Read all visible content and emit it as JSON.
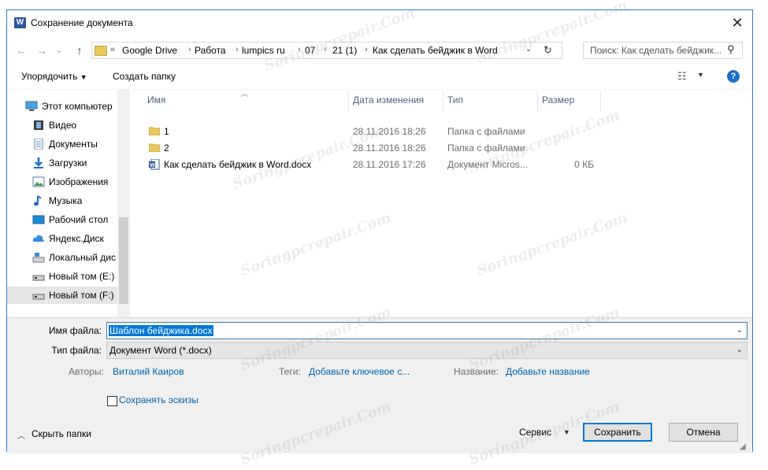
{
  "window": {
    "title": "Сохранение документа",
    "app_icon": "W",
    "close": "✕"
  },
  "nav": {
    "back": "←",
    "forward": "→",
    "dropdown": "⌄",
    "up": "↑",
    "breadcrumb": [
      "Google Drive",
      "Работа",
      "lumpics ru",
      "07",
      "21 (1)",
      "Как сделать бейджик в Word"
    ],
    "search_placeholder": "Поиск: Как сделать бейджик..."
  },
  "toolbar": {
    "organize": "Упорядочить",
    "new_folder": "Создать папку",
    "help": "?"
  },
  "sidebar": {
    "items": [
      {
        "label": "Этот компьютер",
        "icon": "computer-icon"
      },
      {
        "label": "Видео",
        "icon": "video-icon"
      },
      {
        "label": "Документы",
        "icon": "documents-icon"
      },
      {
        "label": "Загрузки",
        "icon": "downloads-icon"
      },
      {
        "label": "Изображения",
        "icon": "pictures-icon"
      },
      {
        "label": "Музыка",
        "icon": "music-icon"
      },
      {
        "label": "Рабочий стол",
        "icon": "desktop-icon"
      },
      {
        "label": "Яндекс.Диск",
        "icon": "cloud-icon"
      },
      {
        "label": "Локальный дис",
        "icon": "local-disk-icon"
      },
      {
        "label": "Новый том (E:)",
        "icon": "drive-icon"
      },
      {
        "label": "Новый том (F:)",
        "icon": "drive-icon"
      }
    ]
  },
  "columns": {
    "name": "Имя",
    "date": "Дата изменения",
    "type": "Тип",
    "size": "Размер"
  },
  "files": [
    {
      "name": "1",
      "date": "28.11.2016 18:26",
      "type": "Папка с файлами",
      "size": "",
      "icon": "folder-icon"
    },
    {
      "name": "2",
      "date": "28.11.2016 18:26",
      "type": "Папка с файлами",
      "size": "",
      "icon": "folder-icon"
    },
    {
      "name": "Как сделать бейджик в Word.docx",
      "date": "28.11.2016 17:26",
      "type": "Документ Micros...",
      "size": "0 КБ",
      "icon": "word-doc-icon"
    }
  ],
  "form": {
    "filename_label": "Имя файла:",
    "filename_value": "Шаблон бейджика.docx",
    "filetype_label": "Тип файла:",
    "filetype_value": "Документ Word (*.docx)",
    "authors_label": "Авторы:",
    "authors_value": "Виталий Каиров",
    "tags_label": "Теги:",
    "tags_value": "Добавьте ключевое с...",
    "title_label": "Название:",
    "title_value": "Добавьте название",
    "thumbnails_label": "Сохранять эскизы"
  },
  "footer": {
    "hide_folders": "Скрыть папки",
    "tools": "Сервис",
    "save": "Сохранить",
    "cancel": "Отмена"
  },
  "watermark": "Soringpcrepair.Com",
  "colors": {
    "accent": "#0078d7",
    "link": "#0063b1",
    "folder": "#e9c75c"
  }
}
